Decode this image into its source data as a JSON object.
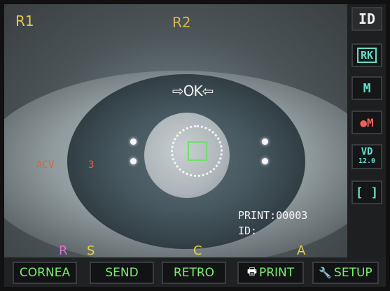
{
  "overlay": {
    "label_r1": "R1",
    "label_r2": "R2",
    "ok_indicator": "⇨OK⇦",
    "acv_label": "ACV",
    "acv_value": "3",
    "print_line": "PRINT:00003",
    "id_line": "ID:"
  },
  "modes": {
    "r": "R",
    "s": "S",
    "c": "C",
    "a": "A"
  },
  "side_buttons": {
    "id": "ID",
    "rk": "RK",
    "m": "M",
    "color_m": "M",
    "vd_top": "VD",
    "vd_value": "12.0",
    "frame": "[ ]"
  },
  "bottom_buttons": {
    "cornea": "CORNEA",
    "send": "SEND",
    "retro": "RETRO",
    "print": "PRINT",
    "setup": "SETUP"
  },
  "colors": {
    "button_text": "#78f06a",
    "side_accent": "#5fe0c8",
    "label_yellow": "#e8c84a",
    "label_orange": "#e0623a"
  }
}
